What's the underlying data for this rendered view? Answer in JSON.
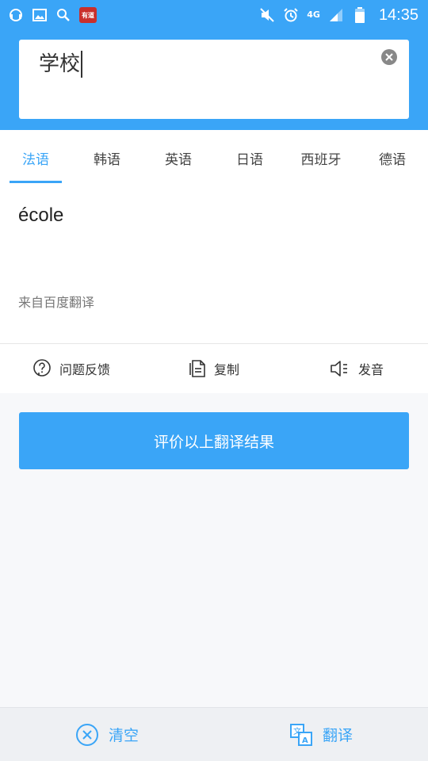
{
  "status_bar": {
    "app_badge": "有道",
    "network": "4G",
    "time": "14:35"
  },
  "input": {
    "value": "学校"
  },
  "tabs": [
    {
      "label": "法语",
      "active": true
    },
    {
      "label": "韩语",
      "active": false
    },
    {
      "label": "英语",
      "active": false
    },
    {
      "label": "日语",
      "active": false
    },
    {
      "label": "西班牙",
      "active": false
    },
    {
      "label": "德语",
      "active": false
    }
  ],
  "result": {
    "text": "école",
    "source": "来自百度翻译"
  },
  "actions": {
    "feedback_label": "问题反馈",
    "copy_label": "复制",
    "speak_label": "发音"
  },
  "evaluate_label": "评价以上翻译结果",
  "bottom": {
    "clear_label": "清空",
    "translate_label": "翻译"
  },
  "colors": {
    "accent": "#3aa5f7"
  }
}
